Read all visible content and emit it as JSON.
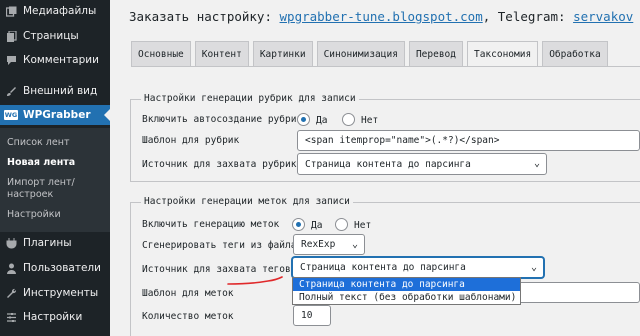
{
  "sidebar": {
    "items": [
      {
        "label": "Медиафайлы",
        "icon": "media-icon"
      },
      {
        "label": "Страницы",
        "icon": "pages-icon"
      },
      {
        "label": "Комментарии",
        "icon": "comments-icon"
      },
      {
        "label": "Внешний вид",
        "icon": "appearance-icon"
      },
      {
        "label": "WPGrabber",
        "icon": "wpgrabber-icon",
        "badge": "WG"
      },
      {
        "label": "Плагины",
        "icon": "plugins-icon"
      },
      {
        "label": "Пользователи",
        "icon": "users-icon"
      },
      {
        "label": "Инструменты",
        "icon": "tools-icon"
      },
      {
        "label": "Настройки",
        "icon": "settings-icon"
      }
    ],
    "submenu": [
      "Список лент",
      "Новая лента",
      "Импорт лент/",
      "настроек",
      "Настройки"
    ],
    "current_submenu": "Новая лента"
  },
  "header": {
    "prefix": "Заказать настройку:",
    "site_link": "wpgrabber-tune.blogspot.com",
    "separator": ", Telegram:",
    "telegram_link": "servakov"
  },
  "tabs": [
    {
      "label": "Основные"
    },
    {
      "label": "Контент"
    },
    {
      "label": "Картинки"
    },
    {
      "label": "Синонимизация"
    },
    {
      "label": "Перевод"
    },
    {
      "label": "Таксономия",
      "active": true
    },
    {
      "label": "Обработка"
    }
  ],
  "rubric_section": {
    "legend": "Настройки генерации рубрик для записи",
    "autocreate_label": "Включить автосоздание рубрик",
    "yes": "Да",
    "no": "Нет",
    "autocreate_value": "Да",
    "template_label": "Шаблон для рубрик",
    "template_value": "<span itemprop=\"name\">(.*?)</span>",
    "source_label": "Источник для захвата рубрик",
    "source_value": "Страница контента до парсинга"
  },
  "tags_section": {
    "legend": "Настройки генерации меток для записи",
    "enable_label": "Включить генерацию меток",
    "yes": "Да",
    "no": "Нет",
    "enable_value": "Да",
    "generate_label": "Сгенерировать теги из файла",
    "generate_value": "RexExp",
    "source_label": "Источник для захвата тегов",
    "source_value": "Страница контента до парсинга",
    "source_options": [
      "Страница контента до парсинга",
      "Полный текст (без обработки шаблонами)"
    ],
    "template_label": "Шаблон для меток",
    "count_label": "Количество меток",
    "count_value": "10"
  },
  "colors": {
    "sidebar_bg": "#1d2327",
    "accent": "#2271b1",
    "highlight": "#1e6fd9",
    "annotation": "#e0292b"
  }
}
